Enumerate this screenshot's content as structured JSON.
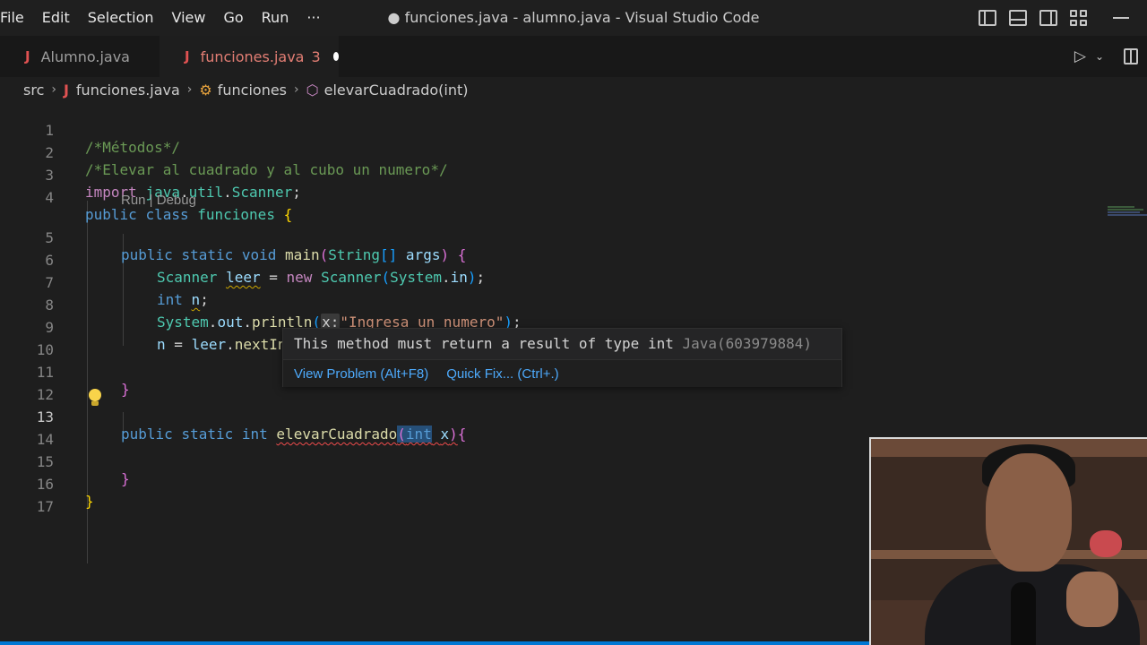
{
  "window": {
    "title": "● funciones.java - alumno.java - Visual Studio Code"
  },
  "menu": {
    "items": [
      "File",
      "Edit",
      "Selection",
      "View",
      "Go",
      "Run",
      "···"
    ]
  },
  "tabs": [
    {
      "icon": "J",
      "label": "Alumno.java"
    },
    {
      "icon": "J",
      "label": "funciones.java",
      "problems": "3"
    }
  ],
  "breadcrumb": {
    "folder": "src",
    "file": "funciones.java",
    "class": "funciones",
    "method": "elevarCuadrado(int)"
  },
  "line_numbers": [
    "1",
    "2",
    "3",
    "4",
    "5",
    "6",
    "7",
    "8",
    "9",
    "10",
    "11",
    "12",
    "13",
    "14",
    "15",
    "16",
    "17"
  ],
  "code": {
    "l1": "/*Métodos*/",
    "l2": "/*Elevar al cuadrado y al cubo un numero*/",
    "codelens": "Run | Debug",
    "l3_import": "import",
    "l3_java": "java",
    "l3_util": "util",
    "l3_scanner": "Scanner",
    "kw_public": "public",
    "kw_class": "class",
    "kw_static": "static",
    "kw_void": "void",
    "kw_int": "int",
    "kw_new": "new",
    "cls_funciones": "funciones",
    "fn_main": "main",
    "type_string": "String",
    "var_args": "args",
    "type_scanner": "Scanner",
    "var_leer": "leer",
    "type_system": "System",
    "var_in": "in",
    "var_n": "n",
    "var_out": "out",
    "fn_println": "println",
    "inlay_x": "x:",
    "str_msg": "\"Ingresa un numero\"",
    "fn_nextint": "nextInt",
    "fn_elevar": "elevarCuadrado",
    "var_x": "x"
  },
  "hover": {
    "message": "This method must return a result of type int",
    "source": "Java(603979884)",
    "view_problem": "View Problem (Alt+F8)",
    "quick_fix": "Quick Fix... (Ctrl+.)"
  },
  "colors": {
    "accent": "#0078d4",
    "error": "#f14c4c",
    "warning": "#cca700",
    "link": "#4daafc"
  }
}
